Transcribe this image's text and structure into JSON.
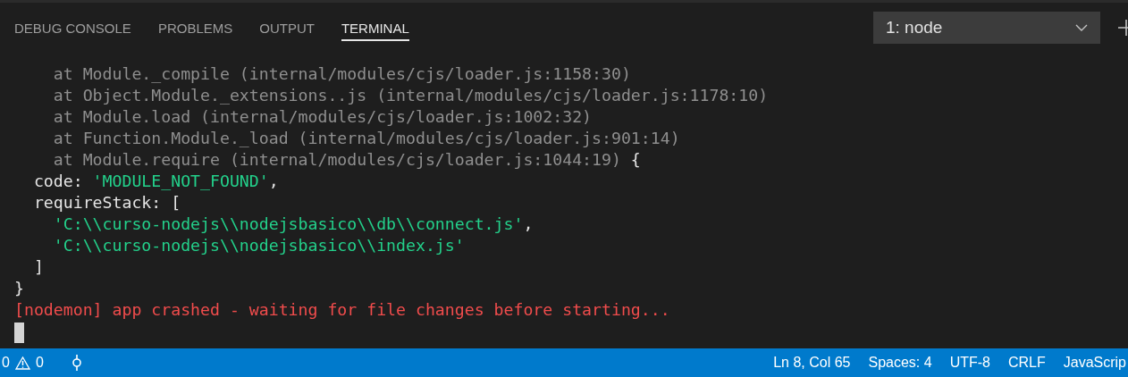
{
  "tabs": [
    {
      "label": "DEBUG CONSOLE",
      "selected": false
    },
    {
      "label": "PROBLEMS",
      "selected": false
    },
    {
      "label": "OUTPUT",
      "selected": false
    },
    {
      "label": "TERMINAL",
      "selected": true
    }
  ],
  "terminal_select": {
    "value": "1: node"
  },
  "terminal": {
    "lines": [
      {
        "segments": [
          {
            "kind": "dim",
            "text": "    at Module._compile (internal/modules/cjs/loader.js:1158:30)"
          }
        ]
      },
      {
        "segments": [
          {
            "kind": "dim",
            "text": "    at Object.Module._extensions..js (internal/modules/cjs/loader.js:1178:10)"
          }
        ]
      },
      {
        "segments": [
          {
            "kind": "dim",
            "text": "    at Module.load (internal/modules/cjs/loader.js:1002:32)"
          }
        ]
      },
      {
        "segments": [
          {
            "kind": "dim",
            "text": "    at Function.Module._load (internal/modules/cjs/loader.js:901:14)"
          }
        ]
      },
      {
        "segments": [
          {
            "kind": "dim",
            "text": "    at Module.require (internal/modules/cjs/loader.js:1044:19)"
          },
          {
            "kind": "plain",
            "text": " {"
          }
        ]
      },
      {
        "segments": [
          {
            "kind": "plain",
            "text": "  code: "
          },
          {
            "kind": "string",
            "text": "'MODULE_NOT_FOUND'"
          },
          {
            "kind": "plain",
            "text": ","
          }
        ]
      },
      {
        "segments": [
          {
            "kind": "plain",
            "text": "  requireStack: ["
          }
        ]
      },
      {
        "segments": [
          {
            "kind": "string",
            "text": "    'C:\\\\curso-nodejs\\\\nodejsbasico\\\\db\\\\connect.js'"
          },
          {
            "kind": "plain",
            "text": ","
          }
        ]
      },
      {
        "segments": [
          {
            "kind": "string",
            "text": "    'C:\\\\curso-nodejs\\\\nodejsbasico\\\\index.js'"
          }
        ]
      },
      {
        "segments": [
          {
            "kind": "plain",
            "text": "  ]"
          }
        ]
      },
      {
        "segments": [
          {
            "kind": "plain",
            "text": "}"
          }
        ]
      },
      {
        "segments": [
          {
            "kind": "error",
            "text": "[nodemon] app crashed - waiting for file changes before starting..."
          }
        ]
      }
    ]
  },
  "status_bar": {
    "errors": "0",
    "warnings": "0",
    "right": [
      "Ln 8, Col 65",
      "Spaces: 4",
      "UTF-8",
      "CRLF",
      "JavaScrip"
    ]
  }
}
